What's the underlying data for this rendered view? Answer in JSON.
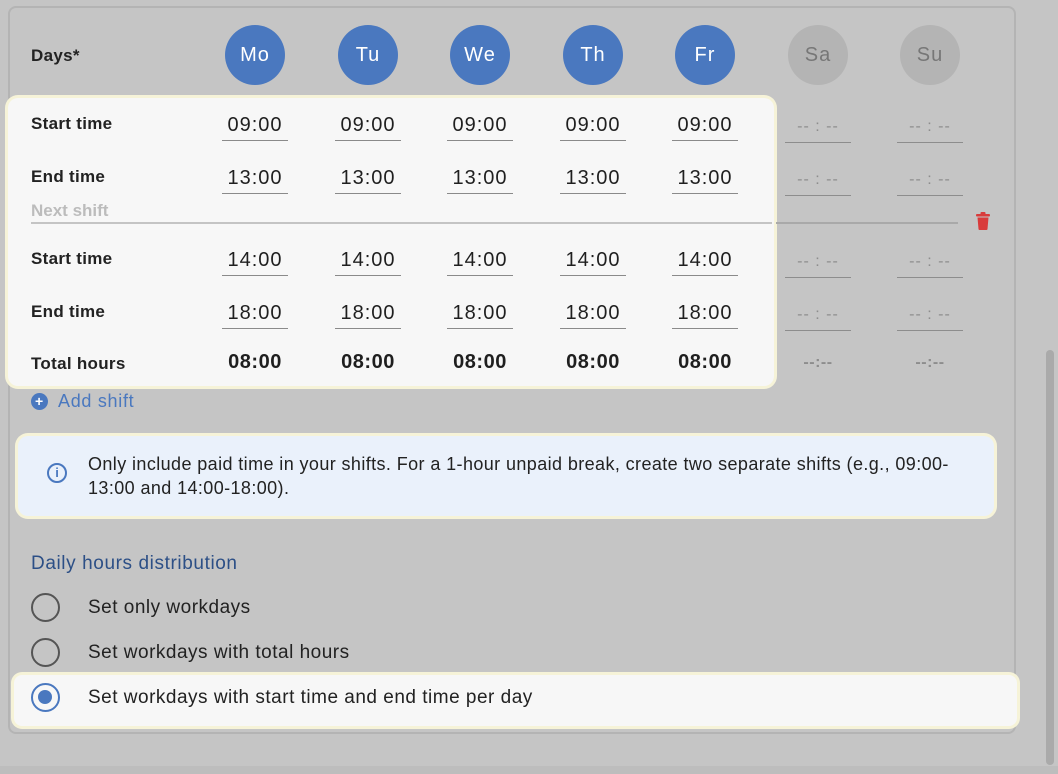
{
  "days_label": "Days*",
  "days": [
    {
      "label": "Mo",
      "active": true
    },
    {
      "label": "Tu",
      "active": true
    },
    {
      "label": "We",
      "active": true
    },
    {
      "label": "Th",
      "active": true
    },
    {
      "label": "Fr",
      "active": true
    },
    {
      "label": "Sa",
      "active": false
    },
    {
      "label": "Su",
      "active": false
    }
  ],
  "shift1": {
    "start_label": "Start time",
    "end_label": "End time",
    "start": [
      "09:00",
      "09:00",
      "09:00",
      "09:00",
      "09:00",
      "-- : --",
      "-- : --"
    ],
    "end": [
      "13:00",
      "13:00",
      "13:00",
      "13:00",
      "13:00",
      "-- : --",
      "-- : --"
    ]
  },
  "next_shift_label": "Next shift",
  "shift2": {
    "start_label": "Start time",
    "end_label": "End time",
    "start": [
      "14:00",
      "14:00",
      "14:00",
      "14:00",
      "14:00",
      "-- : --",
      "-- : --"
    ],
    "end": [
      "18:00",
      "18:00",
      "18:00",
      "18:00",
      "18:00",
      "-- : --",
      "-- : --"
    ]
  },
  "total_label": "Total hours",
  "totals": [
    "08:00",
    "08:00",
    "08:00",
    "08:00",
    "08:00",
    "--:--",
    "--:--"
  ],
  "add_shift_label": "Add shift",
  "info_text": "Only include paid time in your shifts. For a 1-hour unpaid break, create two separate shifts (e.g., 09:00-13:00 and 14:00-18:00).",
  "distribution": {
    "title": "Daily hours distribution",
    "options": [
      {
        "label": "Set only workdays",
        "checked": false
      },
      {
        "label": "Set workdays with total hours",
        "checked": false
      },
      {
        "label": "Set workdays with start time and end time per day",
        "checked": true
      }
    ]
  },
  "colors": {
    "accent": "#4a78bf",
    "inactive_day": "#b4b4b4",
    "delete": "#d93b3b"
  }
}
